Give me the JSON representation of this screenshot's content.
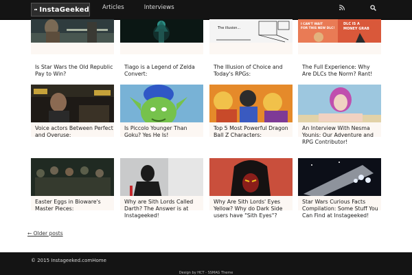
{
  "header": {
    "logo_text": "InstaGeeked",
    "nav": [
      "Articles",
      "Interviews"
    ],
    "icons": [
      "rss-icon",
      "search-icon"
    ]
  },
  "posts": [
    {
      "title": "Is Star Wars the Old Republic Pay to Win?"
    },
    {
      "title": "Tiago is a Legend of Zelda Convert:"
    },
    {
      "title": "The Illusion of Choice and Today's RPGs:",
      "image_text": "The illusion..."
    },
    {
      "title": "The Full Experience: Why Are DLCs the Norm? Rant!",
      "image_text_left": "I CAN'T WAIT FOR THIS NEW DLC!",
      "image_text_right": "DLC IS A MONEY GRAB"
    },
    {
      "title": "Voice actors Between Perfect and Overuse:"
    },
    {
      "title": "Is Piccolo Younger Than Goku? Yes He Is!"
    },
    {
      "title": "Top 5 Most Powerful Dragon Ball Z Characters:"
    },
    {
      "title": "An Interview With Nesma Younis: Our Adventure and RPG Contributor!"
    },
    {
      "title": "Easter Eggs in Bioware's Master Pieces:"
    },
    {
      "title": "Why are Sith Lords Called Darth? The Answer is at Instageeked!"
    },
    {
      "title": "Why Are Sith Lords' Eyes Yellow? Why do Dark Side users have \"Sith Eyes\"?"
    },
    {
      "title": "Star Wars Curious Facts Compilation: Some Stuff You Can Find at Instageeked!"
    }
  ],
  "pagination": {
    "older": "← Older posts"
  },
  "footer": {
    "copyright": "© 2015 Instageeked.com",
    "home_link": "Home",
    "credit": "Design by HCT - SSMAG Theme"
  },
  "colors": {
    "header_bg": "#141414",
    "card_bg": "#fcf7f3",
    "page_bg": "#ffffff"
  }
}
